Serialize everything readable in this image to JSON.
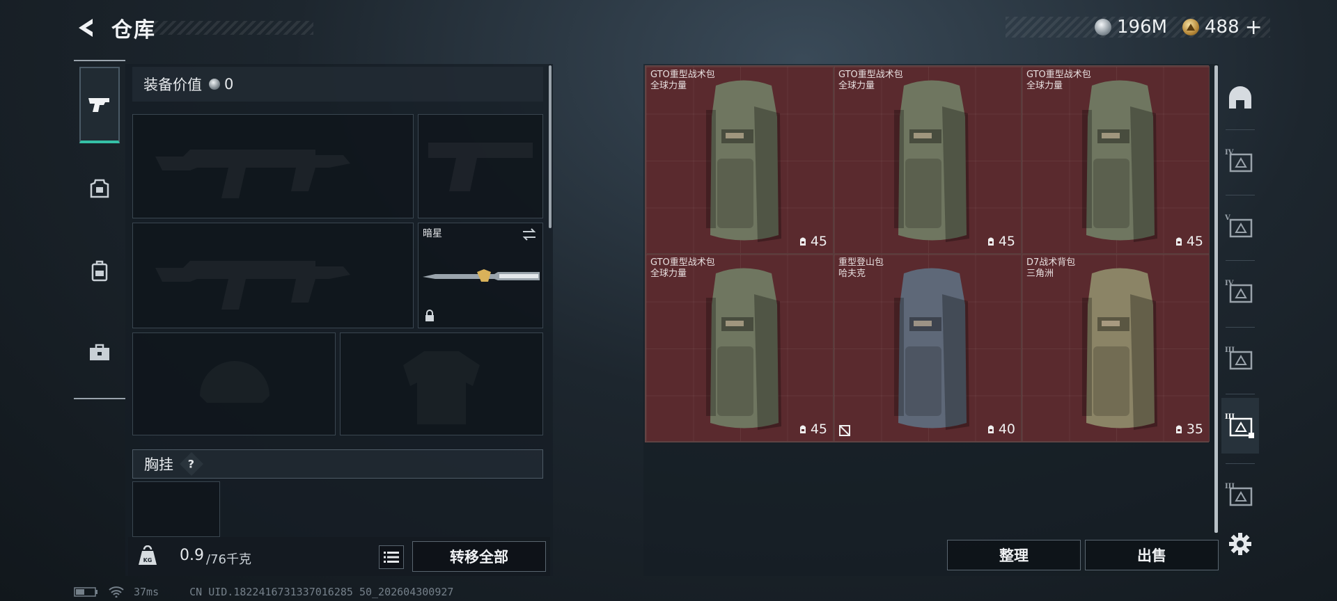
{
  "header": {
    "title": "仓库",
    "currencies": [
      {
        "icon": "silver-coin-icon",
        "value": "196M",
        "color": "#c0c8d0"
      },
      {
        "icon": "gold-triangle-coin-icon",
        "value": "488",
        "add": "+",
        "color": "#d8b060"
      }
    ]
  },
  "left_tabs": [
    {
      "icon": "pistol-icon",
      "active": true
    },
    {
      "icon": "armor-plate-icon",
      "active": false
    },
    {
      "icon": "backpack-icon",
      "active": false
    },
    {
      "icon": "toolbox-icon",
      "active": false
    }
  ],
  "loadout": {
    "equip_value_label": "装备价值",
    "equip_value": "0",
    "melee_name": "暗星",
    "vest_label": "胸挂",
    "vest_help": "?",
    "weight_current": "0.9",
    "weight_max": "/76千克",
    "weight_icon_text": "KG",
    "transfer_all": "转移全部"
  },
  "inventory": {
    "items": [
      {
        "name": "GTO重型战术包",
        "sub": "全球力量",
        "durability": "45",
        "tint": "#6f7660",
        "flag": false
      },
      {
        "name": "GTO重型战术包",
        "sub": "全球力量",
        "durability": "45",
        "tint": "#6f7660",
        "flag": false
      },
      {
        "name": "GTO重型战术包",
        "sub": "全球力量",
        "durability": "45",
        "tint": "#6f7660",
        "flag": false
      },
      {
        "name": "GTO重型战术包",
        "sub": "全球力量",
        "durability": "45",
        "tint": "#6f7660",
        "flag": false
      },
      {
        "name": "重型登山包",
        "sub": "哈夫克",
        "durability": "40",
        "tint": "#5e6878",
        "flag": true
      },
      {
        "name": "D7战术背包",
        "sub": "三角洲",
        "durability": "35",
        "tint": "#8b8466",
        "flag": false
      }
    ],
    "sort_label": "整理",
    "sell_label": "出售"
  },
  "filters": [
    {
      "icon": "helmet-filter-icon",
      "active": false
    },
    {
      "icon": "tier-iv-chest-rig-icon",
      "level": "IV",
      "active": false
    },
    {
      "icon": "tier-v-chest-rig-icon",
      "level": "V",
      "active": false
    },
    {
      "icon": "tier-iv-rig-icon",
      "level": "IV",
      "active": false
    },
    {
      "icon": "tier-iii-backpack-icon",
      "level": "III",
      "active": false
    },
    {
      "icon": "tier-iii-backpack-selected-icon",
      "level": "III",
      "active": true
    },
    {
      "icon": "tier-iii-misc-icon",
      "level": "III",
      "active": false
    }
  ],
  "status": {
    "ping": "37ms",
    "uid": "CN UID.1822416731337016285 50_202604300927"
  }
}
